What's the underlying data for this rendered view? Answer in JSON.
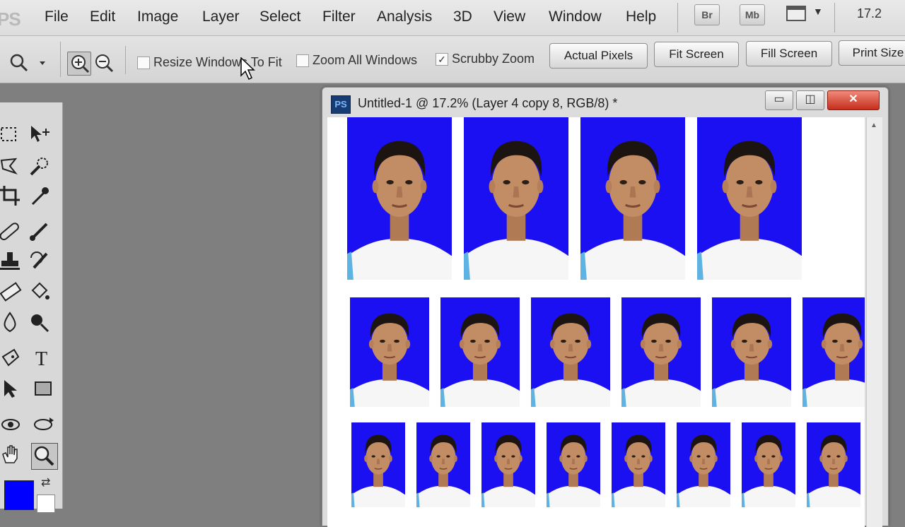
{
  "menubar": {
    "logo": "PS",
    "items": [
      "File",
      "Edit",
      "Image",
      "Layer",
      "Select",
      "Filter",
      "Analysis",
      "3D",
      "View",
      "Window",
      "Help"
    ],
    "app_buttons": [
      "Br",
      "Mb"
    ],
    "zoom_readout": "17.2"
  },
  "options": {
    "resize_windows": {
      "label": "Resize Windows To Fit",
      "checked": false
    },
    "zoom_all": {
      "label": "Zoom All Windows",
      "checked": false
    },
    "scrubby": {
      "label": "Scrubby Zoom",
      "checked": true
    },
    "buttons": [
      "Actual Pixels",
      "Fit Screen",
      "Fill Screen",
      "Print Size"
    ]
  },
  "colors": {
    "foreground": "#0000ff",
    "background": "#ffffff",
    "photo_bg": "#1a10f2"
  },
  "document": {
    "title": "Untitled-1 @ 17.2% (Layer 4 copy 8, RGB/8) *",
    "icon": "PS",
    "photo_rows": [
      4,
      6,
      8
    ]
  },
  "tools": [
    "marquee-tool",
    "move-tool",
    "lasso-tool",
    "quick-selection-tool",
    "crop-tool",
    "eyedropper-tool",
    "healing-brush-tool",
    "brush-tool",
    "clone-stamp-tool",
    "history-brush-tool",
    "eraser-tool",
    "paint-bucket-tool",
    "blur-tool",
    "dodge-tool",
    "pen-tool",
    "type-tool",
    "path-selection-tool",
    "rectangle-tool",
    "3d-rotate-tool",
    "3d-orbit-tool",
    "hand-tool",
    "zoom-tool"
  ]
}
